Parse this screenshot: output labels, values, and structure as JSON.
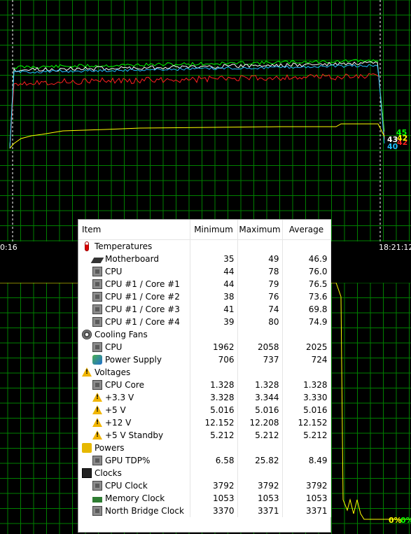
{
  "colors": {
    "grid": "#008000",
    "background": "#000000",
    "motherboard": "#ffffff",
    "cpu": "#00ff00",
    "core1": "#aaffaa",
    "core2": "#ff2020",
    "core3": "#ffffff",
    "core4": "#20c0ff",
    "load": "#ffff00"
  },
  "top_graph": {
    "time_start": "0:16",
    "time_end": "18:21:12",
    "readouts": [
      {
        "value": "45",
        "color": "#00ff00"
      },
      {
        "value": "43",
        "color": "#ffffff"
      },
      {
        "value": "42",
        "color": "#ff2020"
      },
      {
        "value": "40",
        "color": "#20c0ff"
      },
      {
        "value": "42",
        "color": "#ffff00"
      }
    ]
  },
  "bottom_graph": {
    "readout_a": "0%",
    "readout_b": "0%"
  },
  "stats": {
    "columns": {
      "item": "Item",
      "min": "Minimum",
      "max": "Maximum",
      "avg": "Average"
    },
    "rows": [
      {
        "label": "Temperatures",
        "icon": "thermometer-icon",
        "level": 1
      },
      {
        "label": "Motherboard",
        "icon": "motherboard-icon",
        "level": 2,
        "min": "35",
        "max": "49",
        "avg": "46.9"
      },
      {
        "label": "CPU",
        "icon": "cpu-chip-icon",
        "level": 2,
        "min": "44",
        "max": "78",
        "avg": "76.0"
      },
      {
        "label": "CPU #1 / Core #1",
        "icon": "cpu-chip-icon",
        "level": 2,
        "min": "44",
        "max": "79",
        "avg": "76.5"
      },
      {
        "label": "CPU #1 / Core #2",
        "icon": "cpu-chip-icon",
        "level": 2,
        "min": "38",
        "max": "76",
        "avg": "73.6"
      },
      {
        "label": "CPU #1 / Core #3",
        "icon": "cpu-chip-icon",
        "level": 2,
        "min": "41",
        "max": "74",
        "avg": "69.8"
      },
      {
        "label": "CPU #1 / Core #4",
        "icon": "cpu-chip-icon",
        "level": 2,
        "min": "39",
        "max": "80",
        "avg": "74.9"
      },
      {
        "label": "Cooling Fans",
        "icon": "fan-icon",
        "level": 1
      },
      {
        "label": "CPU",
        "icon": "cpu-chip-icon",
        "level": 2,
        "min": "1962",
        "max": "2058",
        "avg": "2025"
      },
      {
        "label": "Power Supply",
        "icon": "power-supply-icon",
        "level": 2,
        "min": "706",
        "max": "737",
        "avg": "724"
      },
      {
        "label": "Voltages",
        "icon": "warning-icon",
        "level": 1
      },
      {
        "label": "CPU Core",
        "icon": "cpu-chip-icon",
        "level": 2,
        "min": "1.328",
        "max": "1.328",
        "avg": "1.328"
      },
      {
        "label": "+3.3 V",
        "icon": "warning-icon",
        "level": 2,
        "min": "3.328",
        "max": "3.344",
        "avg": "3.330"
      },
      {
        "label": "+5 V",
        "icon": "warning-icon",
        "level": 2,
        "min": "5.016",
        "max": "5.016",
        "avg": "5.016"
      },
      {
        "label": "+12 V",
        "icon": "warning-icon",
        "level": 2,
        "min": "12.152",
        "max": "12.208",
        "avg": "12.152"
      },
      {
        "label": "+5 V Standby",
        "icon": "warning-icon",
        "level": 2,
        "min": "5.212",
        "max": "5.212",
        "avg": "5.212"
      },
      {
        "label": "Powers",
        "icon": "power-plug-icon",
        "level": 1
      },
      {
        "label": "GPU TDP%",
        "icon": "cpu-chip-icon",
        "level": 2,
        "min": "6.58",
        "max": "25.82",
        "avg": "8.49"
      },
      {
        "label": "Clocks",
        "icon": "clock-icon",
        "level": 1
      },
      {
        "label": "CPU Clock",
        "icon": "cpu-chip-icon",
        "level": 2,
        "min": "3792",
        "max": "3792",
        "avg": "3792"
      },
      {
        "label": "Memory Clock",
        "icon": "memory-icon",
        "level": 2,
        "min": "1053",
        "max": "1053",
        "avg": "1053"
      },
      {
        "label": "North Bridge Clock",
        "icon": "cpu-chip-icon",
        "level": 2,
        "min": "3370",
        "max": "3371",
        "avg": "3371"
      }
    ]
  }
}
